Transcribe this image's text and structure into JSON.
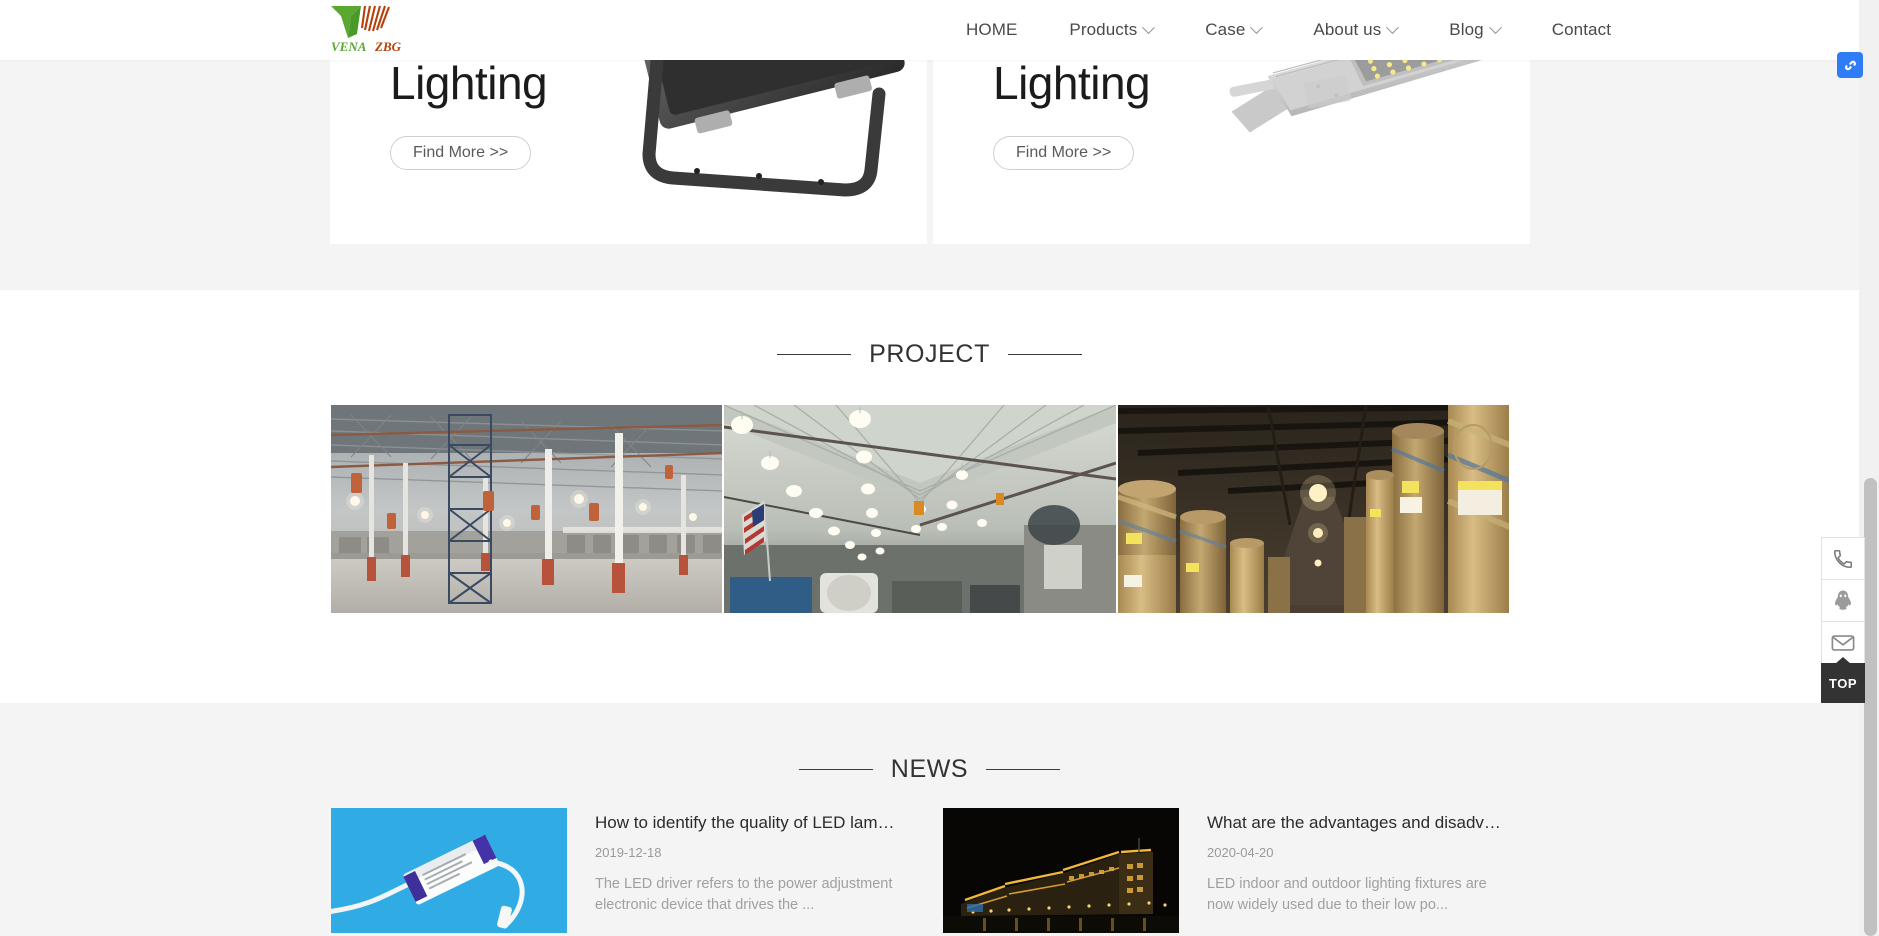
{
  "header": {
    "logo": {
      "mark": "vena-zbg-logo",
      "text_left": "VENA",
      "text_right": "ZBG"
    },
    "nav": [
      {
        "label": "HOME",
        "has_dropdown": false,
        "name": "nav-item-home"
      },
      {
        "label": "Products",
        "has_dropdown": true,
        "name": "nav-item-products"
      },
      {
        "label": "Case",
        "has_dropdown": true,
        "name": "nav-item-case"
      },
      {
        "label": "About us",
        "has_dropdown": true,
        "name": "nav-item-about-us"
      },
      {
        "label": "Blog",
        "has_dropdown": true,
        "name": "nav-item-blog"
      },
      {
        "label": "Contact",
        "has_dropdown": false,
        "name": "nav-item-contact"
      }
    ]
  },
  "banner": {
    "cards": [
      {
        "title": "Lighting",
        "cta": "Find More >>",
        "image": "led-flood-light-black"
      },
      {
        "title": "Lighting",
        "cta": "Find More >>",
        "image": "led-street-light-grey"
      }
    ]
  },
  "project": {
    "heading": "PROJECT",
    "images": [
      {
        "alt": "empty-warehouse-high-bay-lighting",
        "name": "project-image-1"
      },
      {
        "alt": "workshop-garage-ceiling-lighting",
        "name": "project-image-2"
      },
      {
        "alt": "paper-roll-warehouse-lighting",
        "name": "project-image-3"
      }
    ]
  },
  "news": {
    "heading": "NEWS",
    "articles": [
      {
        "title": "How to identify the quality of LED lamp driver",
        "date": "2019-12-18",
        "excerpt": "The LED driver refers to the power adjustment electronic device that drives the ...",
        "thumb": "led-driver-on-blue-background"
      },
      {
        "title": "What are the advantages and disadvantag…",
        "date": "2020-04-20",
        "excerpt": "LED indoor and outdoor lighting fixtures are now widely used due to their low po...",
        "thumb": "illuminated-building-at-night"
      }
    ]
  },
  "side_tools": {
    "buttons": [
      {
        "icon": "phone-icon",
        "name": "side-tool-phone"
      },
      {
        "icon": "qq-penguin-icon",
        "name": "side-tool-qq"
      },
      {
        "icon": "email-icon",
        "name": "side-tool-email"
      }
    ],
    "top_label": "TOP"
  },
  "browser_extension": {
    "icon": "sogou-s-icon",
    "color": "#2f7cf6"
  },
  "colors": {
    "page_bg": "#ffffff",
    "section_gray": "#f4f4f4",
    "nav_text": "#4a4a4a",
    "heading_text": "#333333",
    "muted_text": "#a0a0a0",
    "accent_blue": "#2f7cf6",
    "logo_green": "#4caf32",
    "logo_orange": "#c2450f",
    "top_button_bg": "#333333"
  }
}
